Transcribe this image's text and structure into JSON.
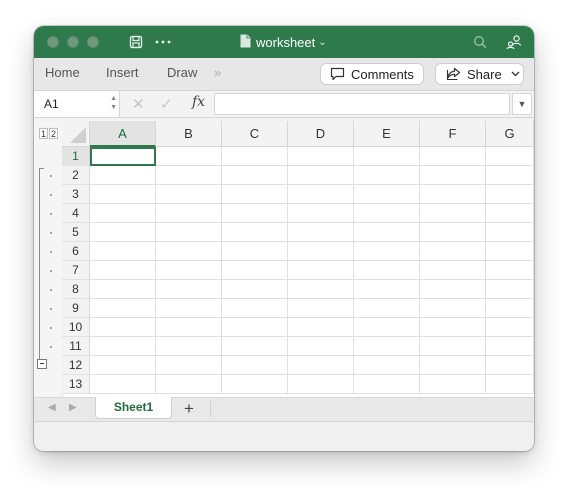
{
  "titlebar": {
    "title": "worksheet",
    "title_chevron": "⌄",
    "icons": [
      "save-icon",
      "more-icon",
      "search-icon",
      "share-people-icon"
    ],
    "accent_color": "#2f7a4d"
  },
  "ribbon": {
    "tabs": [
      "Home",
      "Insert",
      "Draw"
    ],
    "more": "»",
    "comments_label": "Comments",
    "share_label": "Share"
  },
  "formula_bar": {
    "name_box": "A1",
    "fx_label": "fx",
    "formula": ""
  },
  "grid": {
    "outline_levels": [
      "1",
      "2"
    ],
    "columns": [
      "A",
      "B",
      "C",
      "D",
      "E",
      "F",
      "G"
    ],
    "rows": [
      "1",
      "2",
      "3",
      "4",
      "5",
      "6",
      "7",
      "8",
      "9",
      "10",
      "11",
      "12",
      "13"
    ],
    "selected_cell": "A1"
  },
  "sheets": {
    "tabs": [
      "Sheet1"
    ],
    "active": "Sheet1",
    "add_label": "+"
  }
}
